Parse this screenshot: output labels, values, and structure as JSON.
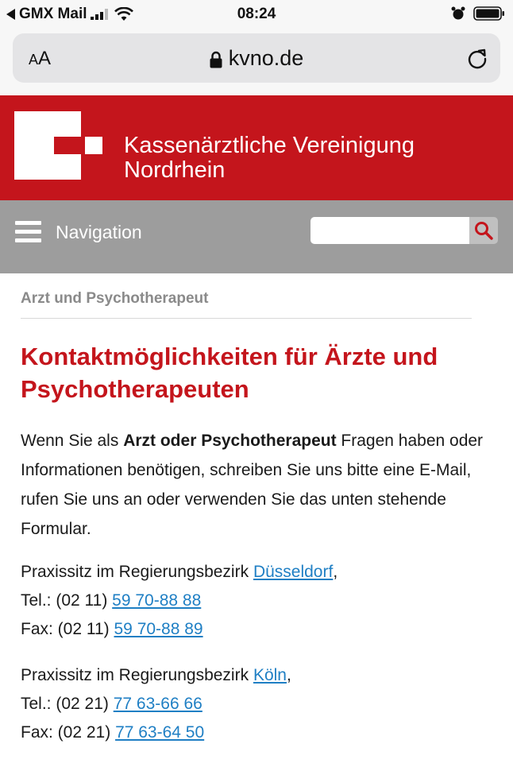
{
  "status_bar": {
    "back_label": "GMX Mail",
    "time": "08:24"
  },
  "url_bar": {
    "text_size_button": "AA",
    "domain": "kvno.de"
  },
  "header": {
    "org_name_line1": "Kassenärztliche Vereinigung",
    "org_name_line2": "Nordrhein"
  },
  "navigation": {
    "menu_label": "Navigation",
    "search_value": ""
  },
  "content": {
    "breadcrumb": "Arzt und Psychotherapeut",
    "title": "Kontaktmöglichkeiten für Ärzte und Psychotherapeuten",
    "intro_before": "Wenn Sie als ",
    "intro_bold": "Arzt oder Psychotherapeut",
    "intro_after": " Fragen haben oder Informationen benötigen, schreiben Sie uns bitte eine E-Mail, rufen Sie uns an oder verwenden Sie das unten stehende Formular.",
    "contacts": [
      {
        "region_prefix": "Praxissitz im Regierungsbezirk ",
        "region_link": "Düsseldorf",
        "region_suffix": ",",
        "tel_prefix": "Tel.: (02 11) ",
        "tel_link": "59 70-88 88",
        "fax_prefix": "Fax: (02 11) ",
        "fax_link": "59 70-88 89"
      },
      {
        "region_prefix": "Praxissitz im Regierungsbezirk ",
        "region_link": "Köln",
        "region_suffix": ",",
        "tel_prefix": "Tel.: (02 21) ",
        "tel_link": "77 63-66 66",
        "fax_prefix": "Fax: (02 21) ",
        "fax_link": "77 63-64 50"
      }
    ]
  },
  "colors": {
    "brand_red": "#c4151c",
    "nav_gray": "#9d9d9d",
    "link_blue": "#1f7fc4",
    "breadcrumb_gray": "#8a8a8a"
  },
  "icons": [
    "back-arrow-icon",
    "signal-icon",
    "wifi-icon",
    "alarm-icon",
    "battery-icon",
    "lock-icon",
    "reload-icon",
    "kvno-logo",
    "hamburger-icon",
    "search-icon"
  ]
}
